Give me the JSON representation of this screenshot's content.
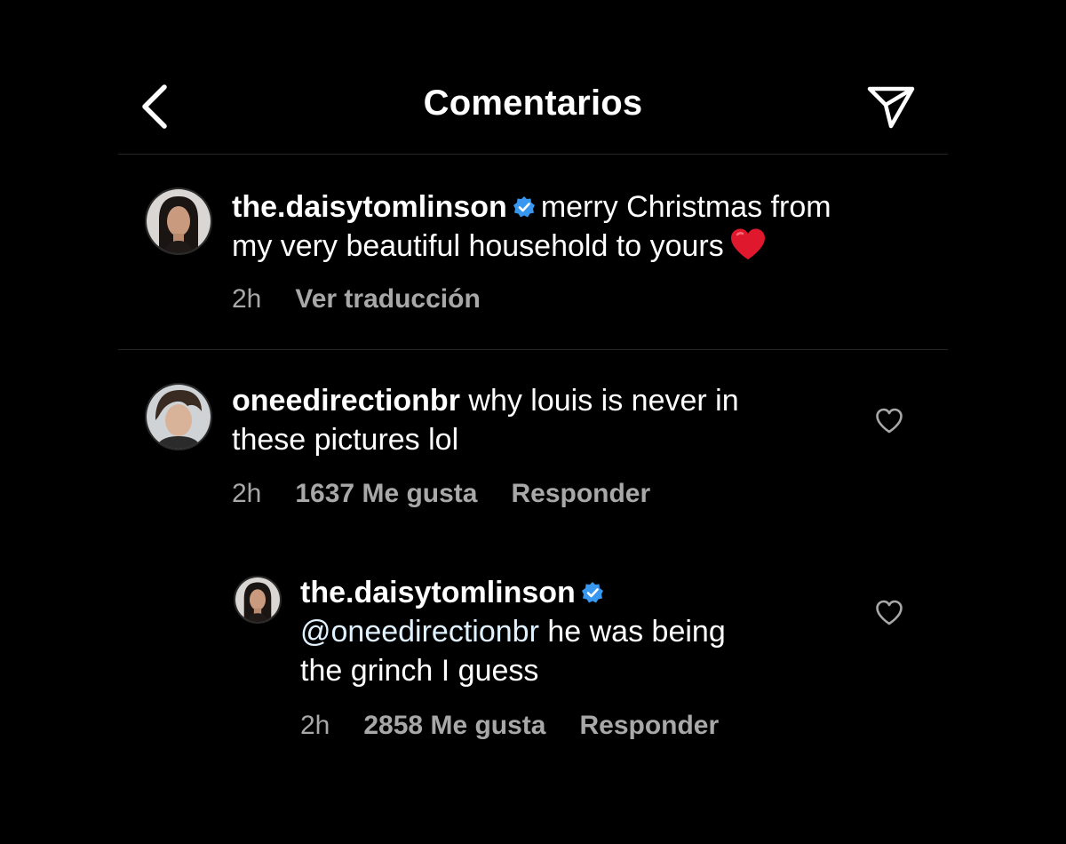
{
  "header": {
    "title": "Comentarios",
    "back_icon": "chevron-left-icon",
    "share_icon": "send-icon"
  },
  "caption": {
    "username": "the.daisytomlinson",
    "verified": true,
    "text_line1": "merry Christmas from",
    "text_line2": "my very beautiful household to yours",
    "emoji": "red-heart-emoji",
    "time": "2h",
    "translate_label": "Ver traducción"
  },
  "comments": [
    {
      "username": "oneedirectionbr",
      "text_line1": "why louis is never in",
      "text_line2": "these pictures lol",
      "time": "2h",
      "likes": "1637 Me gusta",
      "reply_label": "Responder"
    },
    {
      "username": "the.daisytomlinson",
      "verified": true,
      "mention": "@oneedirectionbr",
      "text_line1": "he was being",
      "text_line2": "the grinch I guess",
      "time": "2h",
      "likes": "2858 Me gusta",
      "reply_label": "Responder"
    }
  ],
  "colors": {
    "background": "#000000",
    "text": "#ffffff",
    "secondary_text": "#a8a8a8",
    "verified_blue": "#3897f0",
    "heart_red": "#e0182d",
    "divider": "#262626"
  }
}
